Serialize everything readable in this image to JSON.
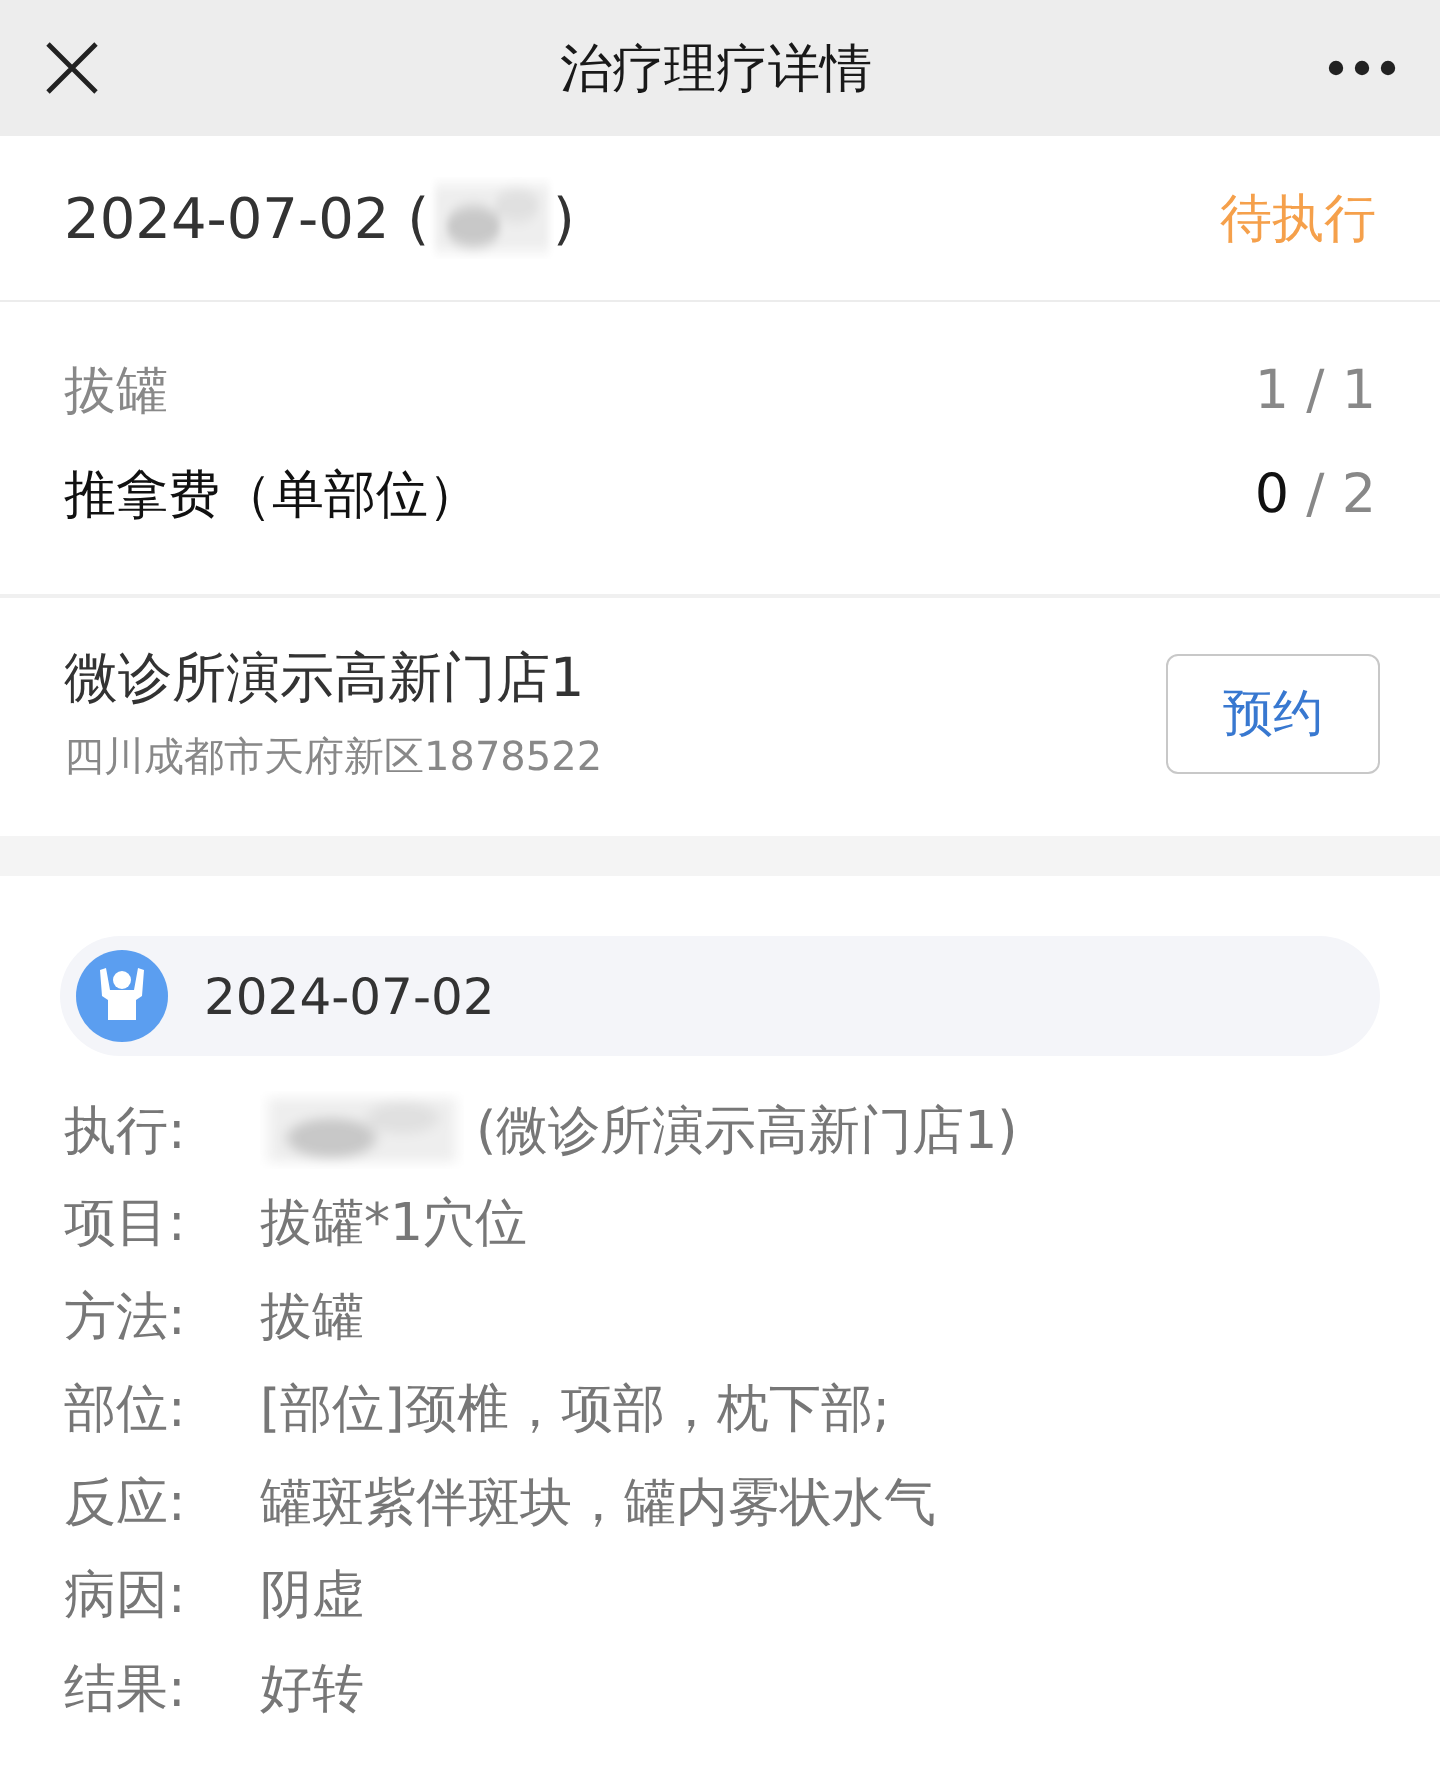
{
  "nav": {
    "title": "治疗理疗详情"
  },
  "order": {
    "date": "2024-07-02 (",
    "date_close": ")",
    "status": "待执行"
  },
  "items": [
    {
      "name": "拔罐",
      "done": "1",
      "total": "/ 1",
      "complete": true
    },
    {
      "name": "推拿费（单部位）",
      "done": "0",
      "total": "/ 2",
      "complete": false
    }
  ],
  "store": {
    "name": "微诊所演示高新门店1",
    "address": "四川成都市天府新区1878522",
    "button": "预约"
  },
  "record": {
    "date": "2024-07-02",
    "fields": [
      {
        "label": "执行:",
        "value": "(微诊所演示高新门店1)",
        "kind": "blurred_prefix"
      },
      {
        "label": "项目:",
        "value": "拔罐*1穴位",
        "kind": "text"
      },
      {
        "label": "方法:",
        "value": "拔罐",
        "kind": "text"
      },
      {
        "label": "部位:",
        "value": "[部位]颈椎，项部，枕下部;",
        "kind": "text"
      },
      {
        "label": "反应:",
        "value": "罐斑紫伴斑块，罐内雾状水气",
        "kind": "text"
      },
      {
        "label": "病因:",
        "value": "阴虚",
        "kind": "text"
      },
      {
        "label": "结果:",
        "value": "好转",
        "kind": "text"
      }
    ]
  }
}
